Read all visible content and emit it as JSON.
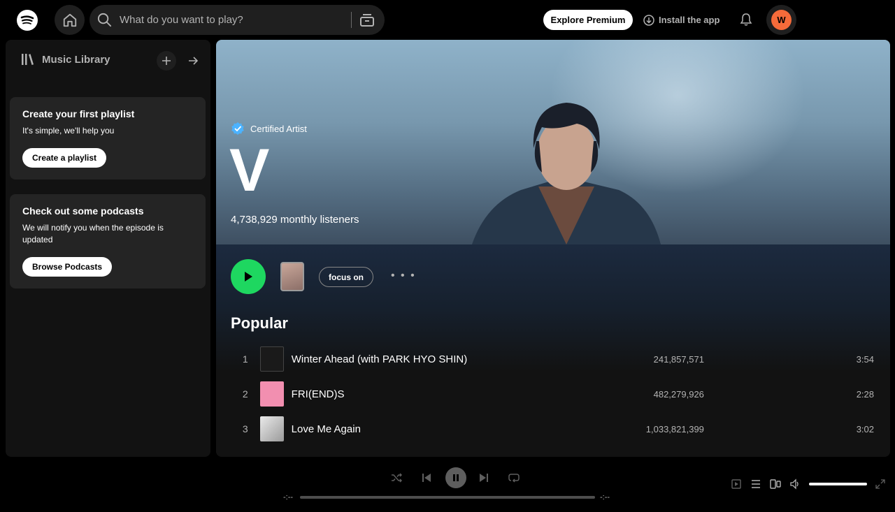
{
  "search": {
    "placeholder": "What do you want to play?"
  },
  "header": {
    "premium_label": "Explore Premium",
    "install_label": "Install the app",
    "avatar_initial": "W"
  },
  "sidebar": {
    "title": "Music Library",
    "cards": [
      {
        "heading": "Create your first playlist",
        "text": "It's simple, we'll help you",
        "button": "Create a playlist"
      },
      {
        "heading": "Check out some podcasts",
        "text": "We will notify you when the episode is updated",
        "button": "Browse Podcasts"
      }
    ]
  },
  "artist": {
    "badge": "Certified Artist",
    "name": "V",
    "listeners": "4,738,929 monthly listeners",
    "focus_label": "focus on",
    "more_label": "• • •"
  },
  "popular": {
    "title": "Popular",
    "tracks": [
      {
        "num": "1",
        "title": "Winter Ahead (with PARK HYO SHIN)",
        "plays": "241,857,571",
        "duration": "3:54",
        "cover_color": "#1a1a1a"
      },
      {
        "num": "2",
        "title": "FRI(END)S",
        "plays": "482,279,926",
        "duration": "2:28",
        "cover_color": "#f28fb0"
      },
      {
        "num": "3",
        "title": "Love Me Again",
        "plays": "1,033,821,399",
        "duration": "3:02",
        "cover_color": "#d9d9d9"
      }
    ]
  },
  "player": {
    "time_elapsed": "-:--",
    "time_total": "-:--",
    "volume": 1.0
  },
  "colors": {
    "accent": "#1ed760",
    "avatar": "#f56b3a"
  }
}
